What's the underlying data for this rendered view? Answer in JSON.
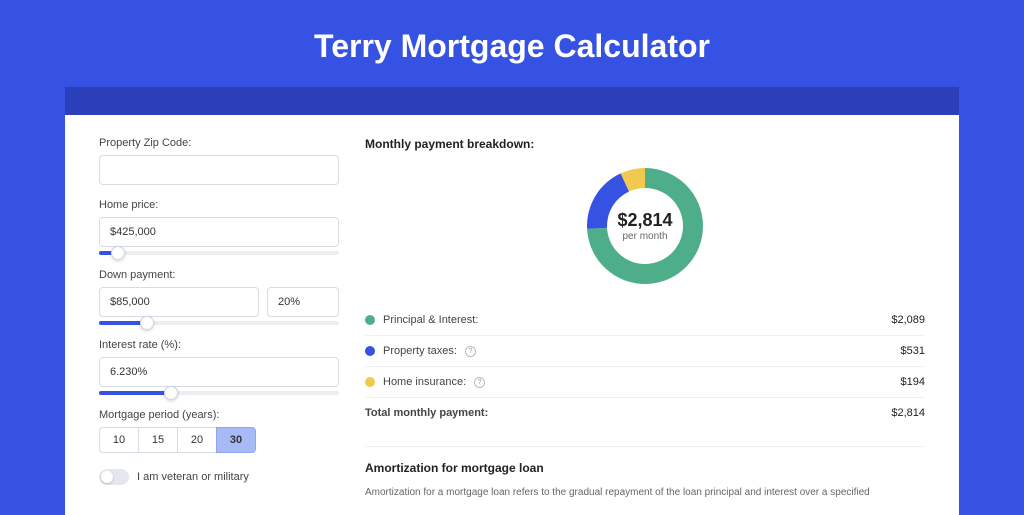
{
  "title": "Terry Mortgage Calculator",
  "form": {
    "zip_label": "Property Zip Code:",
    "zip_value": "",
    "home_price_label": "Home price:",
    "home_price_value": "$425,000",
    "home_price_slider_pct": 8,
    "down_payment_label": "Down payment:",
    "down_payment_value": "$85,000",
    "down_payment_pct": "20%",
    "down_payment_slider_pct": 20,
    "interest_label": "Interest rate (%):",
    "interest_value": "6.230%",
    "interest_slider_pct": 30,
    "period_label": "Mortgage period (years):",
    "period_options": [
      "10",
      "15",
      "20",
      "30"
    ],
    "period_selected": "30",
    "veteran_label": "I am veteran or military",
    "veteran_on": false
  },
  "breakdown": {
    "title": "Monthly payment breakdown:",
    "center_value": "$2,814",
    "center_label": "per month",
    "items": [
      {
        "label": "Principal & Interest:",
        "value": "$2,089",
        "color": "#4fae8a",
        "info": false
      },
      {
        "label": "Property taxes:",
        "value": "$531",
        "color": "#3652e3",
        "info": true
      },
      {
        "label": "Home insurance:",
        "value": "$194",
        "color": "#f1c94f",
        "info": true
      }
    ],
    "total_label": "Total monthly payment:",
    "total_value": "$2,814"
  },
  "chart_data": {
    "type": "pie",
    "series": [
      {
        "name": "Principal & Interest",
        "value": 2089,
        "color": "#4fae8a"
      },
      {
        "name": "Property taxes",
        "value": 531,
        "color": "#3652e3"
      },
      {
        "name": "Home insurance",
        "value": 194,
        "color": "#f1c94f"
      }
    ],
    "title": "Monthly payment breakdown",
    "total": 2814
  },
  "amortization": {
    "title": "Amortization for mortgage loan",
    "text": "Amortization for a mortgage loan refers to the gradual repayment of the loan principal and interest over a specified"
  }
}
